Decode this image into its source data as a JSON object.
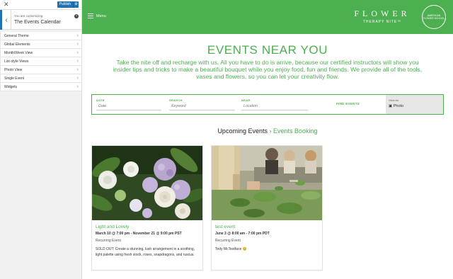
{
  "customizer": {
    "publish_label": "Publish",
    "customizing_label": "You are customizing",
    "section_title": "The Events Calendar",
    "menu_items": [
      {
        "label": "General Theme"
      },
      {
        "label": "Global Elements"
      },
      {
        "label": "Month/Week View"
      },
      {
        "label": "List-style Views"
      },
      {
        "label": "Photo View"
      },
      {
        "label": "Single Event"
      },
      {
        "label": "Widgets"
      }
    ]
  },
  "site": {
    "menu_label": "Menu",
    "logo_main": "FLOWER",
    "logo_sub": "THERAPY NITE™",
    "badge_text": "AMERICAN FLOWER SCHOOL",
    "headline": "EVENTS NEAR YOU",
    "intro": "Take the nite off and recharge with us. All you have to do is arrive, because our certified instructors will show you insider tips and tricks to make a beautiful bouquet while you enjoy food, fun and friends. We provide all of the tools, vases and flowers, so you can let your creativity flow.",
    "search": {
      "date_label": "DATE",
      "date_placeholder": "Date",
      "search_label": "SEARCH",
      "search_placeholder": "Keyword",
      "near_label": "NEAR",
      "near_placeholder": "Location",
      "find_label": "FIND EVENTS",
      "view_as_label": "View As",
      "view_as_value": "Photo"
    },
    "upcoming_label": "Upcoming Events",
    "separator": "›",
    "booking_label": "Events Booking"
  },
  "events": [
    {
      "title": "Light and Lovely",
      "date": "March 10 @ 7:00 pm - November 21 @ 9:00 pm PST",
      "recurring": "Recurring Event",
      "description": "SOLD OUT: Create a stunning, lush arrangement in a soothing, light palette using fresh stock, roses, snapdragons, and ruscus."
    },
    {
      "title": "test event",
      "date": "June 3 @ 8:00 am - 7:00 pm PDT",
      "recurring": "Recurring Event",
      "description": "Tedy McTestface 😊"
    }
  ],
  "colors": {
    "brand_green": "#4caf50",
    "publish_blue": "#2271b1"
  }
}
